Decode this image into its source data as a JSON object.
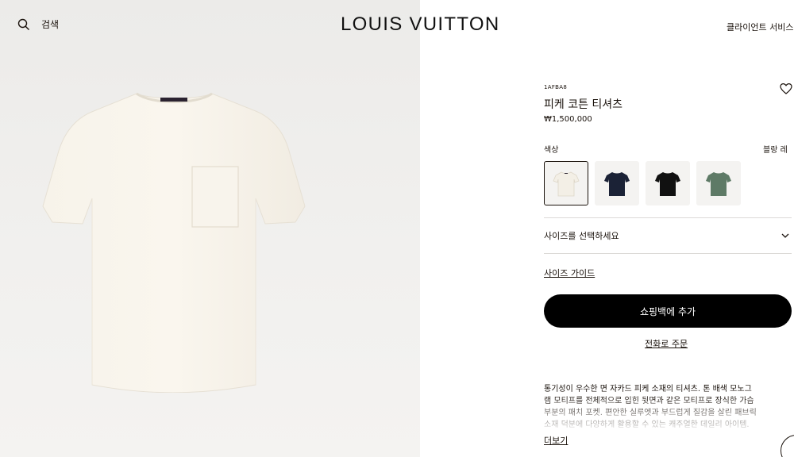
{
  "header": {
    "search_label": "검색",
    "brand": "LOUIS VUITTON",
    "client_service": "클라이언트 서비스"
  },
  "product": {
    "sku": "1AFBA8",
    "name": "피케 코튼 티셔츠",
    "price": "₩1,500,000",
    "color_label": "색상",
    "color_value": "블랑 레",
    "swatches": [
      {
        "name": "white",
        "color": "#f3efe6",
        "selected": true
      },
      {
        "name": "navy",
        "color": "#1b2236",
        "selected": false
      },
      {
        "name": "black",
        "color": "#111111",
        "selected": false
      },
      {
        "name": "green",
        "color": "#5e7a66",
        "selected": false
      }
    ],
    "size_select": "사이즈를 선택하세요",
    "size_guide": "사이즈 가이드",
    "add_to_bag": "쇼핑백에 추가",
    "phone_order": "전화로 주문",
    "description_lines": [
      "통기성이 우수한 면 자카드 피케 소재의 티셔츠. 톤 배색 모노그",
      "램 모티프를 전체적으로 입힌 뒷면과 같은 모티프로 장식한 가슴",
      "부분의 패치 포켓. 편안한 실루엣과 부드럽게 질감을 살린 패브릭",
      "소재 덕분에 다양하게 활용할 수 있는 캐주얼한 데일리 아이템."
    ],
    "read_more": "더보기"
  },
  "icons": {
    "search": "search-icon",
    "wishlist": "heart-icon",
    "chevron": "chevron-down-icon"
  },
  "colors": {
    "button_bg": "#000000",
    "text": "#19110b",
    "image_bg": "#efeeec"
  }
}
